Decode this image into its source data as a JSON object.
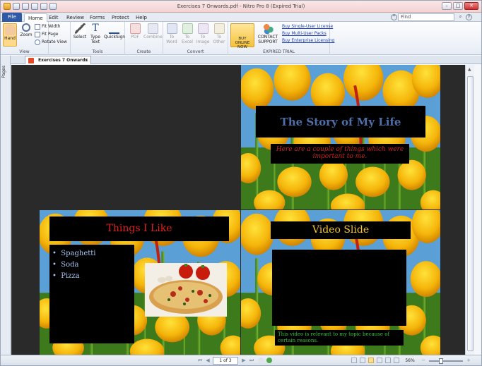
{
  "window": {
    "title": "Exercises 7 Onwards.pdf - Nitro Pro 8 (Expired Trial)"
  },
  "ribbon_tabs": {
    "file": "File",
    "home": "Home",
    "edit": "Edit",
    "review": "Review",
    "forms": "Forms",
    "protect": "Protect",
    "help": "Help"
  },
  "search": {
    "placeholder": "Find"
  },
  "ribbon": {
    "view": {
      "hand": "Hand",
      "zoom": "Zoom",
      "fit_width": "Fit Width",
      "fit_page": "Fit Page",
      "rotate_view": "Rotate View",
      "label": "View"
    },
    "tools": {
      "select": "Select",
      "type_text": "Type Text",
      "quicksign": "QuickSign",
      "label": "Tools"
    },
    "create": {
      "pdf": "PDF",
      "combine": "Combine",
      "label": "Create"
    },
    "convert": {
      "to_word": "To Word",
      "to_excel": "To Excel",
      "to_image": "To Image",
      "to_other": "To Other",
      "label": "Convert"
    },
    "expired": {
      "buy_online": "BUY ONLINE NOW",
      "contact_support": "CONTACT SUPPORT",
      "link1": "Buy Single-User License",
      "link2": "Buy Multi-User Packs",
      "link3": "Buy Enterprise Licensing",
      "label": "EXPIRED TRIAL"
    }
  },
  "side_panel": {
    "pages": "Pages"
  },
  "doc_tab": {
    "name": "Exercises 7 Onwards",
    "close": "×"
  },
  "slides": {
    "story": {
      "title": "The Story of My Life",
      "subtitle": "Here are a couple of things which were important to me."
    },
    "likes": {
      "title": "Things I Like",
      "items": [
        "Spaghetti",
        "Soda",
        "Pizza"
      ]
    },
    "video": {
      "title": "Video Slide",
      "caption": "This video is relevant to my topic because of certain reasons."
    }
  },
  "status": {
    "page": "1 of 3",
    "zoom": "56%"
  },
  "colors": {
    "story_title": "#4e6fa8",
    "subtitle": "#d02020",
    "likes_title": "#e02020",
    "video_title": "#f2c230",
    "list_text": "#a8c4ee",
    "caption": "#35c03a"
  }
}
